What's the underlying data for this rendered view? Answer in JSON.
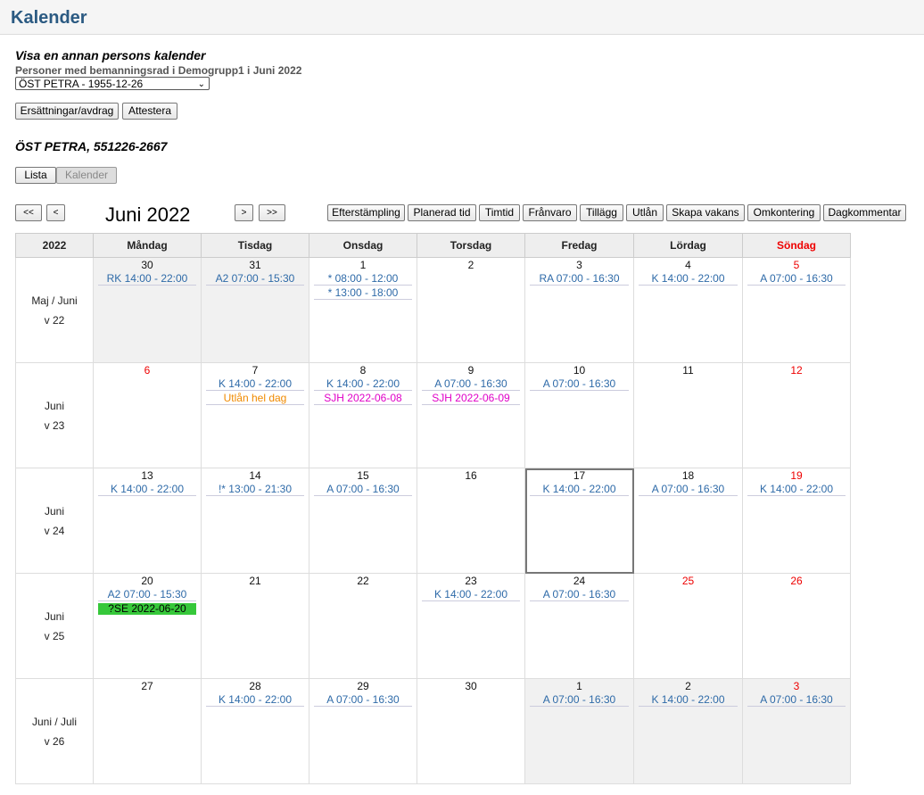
{
  "app_title": "Kalender",
  "section_title": "Visa en annan persons kalender",
  "subtitle": "Personer med bemanningsrad i Demogrupp1 i Juni 2022",
  "person_select": {
    "value": "ÖST PETRA - 1955-12-26",
    "arrow": "⌄"
  },
  "buttons": {
    "ersattningar": "Ersättningar/avdrag",
    "attestera": "Attestera"
  },
  "person_heading": "ÖST PETRA, 551226-2667",
  "view_tabs": {
    "lista": "Lista",
    "kalender": "Kalender"
  },
  "nav": {
    "first": "<<",
    "prev": "<",
    "next": ">",
    "last": ">>"
  },
  "month_title": "Juni 2022",
  "actions": [
    "Efterstämpling",
    "Planerad tid",
    "Timtid",
    "Frånvaro",
    "Tillägg",
    "Utlån",
    "Skapa vakans",
    "Omkontering",
    "Dagkommentar"
  ],
  "table": {
    "year": "2022",
    "days": [
      "Måndag",
      "Tisdag",
      "Onsdag",
      "Torsdag",
      "Fredag",
      "Lördag",
      "Söndag"
    ],
    "weeks": [
      {
        "month": "Maj / Juni",
        "week": "v 22",
        "cells": [
          {
            "day": "30",
            "grey": true,
            "events": [
              {
                "text": "RK 14:00 - 22:00"
              }
            ]
          },
          {
            "day": "31",
            "grey": true,
            "events": [
              {
                "text": "A2 07:00 - 15:30"
              }
            ]
          },
          {
            "day": "1",
            "events": [
              {
                "text": "* 08:00 - 12:00"
              },
              {
                "text": "* 13:00 - 18:00"
              }
            ]
          },
          {
            "day": "2",
            "events": []
          },
          {
            "day": "3",
            "events": [
              {
                "text": "RA 07:00 - 16:30"
              }
            ]
          },
          {
            "day": "4",
            "events": [
              {
                "text": "K 14:00 - 22:00"
              }
            ]
          },
          {
            "day": "5",
            "red": true,
            "events": [
              {
                "text": "A 07:00 - 16:30"
              }
            ]
          }
        ]
      },
      {
        "month": "Juni",
        "week": "v 23",
        "cells": [
          {
            "day": "6",
            "red": true,
            "events": []
          },
          {
            "day": "7",
            "events": [
              {
                "text": "K 14:00 - 22:00"
              },
              {
                "text": "Utlån hel dag",
                "style": "orange"
              }
            ]
          },
          {
            "day": "8",
            "events": [
              {
                "text": "K 14:00 - 22:00"
              },
              {
                "text": "SJH 2022-06-08",
                "style": "magenta"
              }
            ]
          },
          {
            "day": "9",
            "events": [
              {
                "text": "A 07:00 - 16:30"
              },
              {
                "text": "SJH 2022-06-09",
                "style": "magenta"
              }
            ]
          },
          {
            "day": "10",
            "events": [
              {
                "text": "A 07:00 - 16:30"
              }
            ]
          },
          {
            "day": "11",
            "events": []
          },
          {
            "day": "12",
            "red": true,
            "events": []
          }
        ]
      },
      {
        "month": "Juni",
        "week": "v 24",
        "cells": [
          {
            "day": "13",
            "events": [
              {
                "text": "K 14:00 - 22:00"
              }
            ]
          },
          {
            "day": "14",
            "events": [
              {
                "text": "!* 13:00 - 21:30"
              }
            ]
          },
          {
            "day": "15",
            "events": [
              {
                "text": "A 07:00 - 16:30"
              }
            ]
          },
          {
            "day": "16",
            "events": []
          },
          {
            "day": "17",
            "today": true,
            "events": [
              {
                "text": "K 14:00 - 22:00"
              }
            ]
          },
          {
            "day": "18",
            "events": [
              {
                "text": "A 07:00 - 16:30"
              }
            ]
          },
          {
            "day": "19",
            "red": true,
            "events": [
              {
                "text": "K 14:00 - 22:00"
              }
            ]
          }
        ]
      },
      {
        "month": "Juni",
        "week": "v 25",
        "cells": [
          {
            "day": "20",
            "events": [
              {
                "text": "A2 07:00 - 15:30"
              },
              {
                "text": "?SE 2022-06-20",
                "style": "greenbg"
              }
            ]
          },
          {
            "day": "21",
            "events": []
          },
          {
            "day": "22",
            "events": []
          },
          {
            "day": "23",
            "events": [
              {
                "text": "K 14:00 - 22:00"
              }
            ]
          },
          {
            "day": "24",
            "events": [
              {
                "text": "A 07:00 - 16:30"
              }
            ]
          },
          {
            "day": "25",
            "red": true,
            "events": []
          },
          {
            "day": "26",
            "red": true,
            "events": []
          }
        ]
      },
      {
        "month": "Juni / Juli",
        "week": "v 26",
        "cells": [
          {
            "day": "27",
            "events": []
          },
          {
            "day": "28",
            "events": [
              {
                "text": "K 14:00 - 22:00"
              }
            ]
          },
          {
            "day": "29",
            "events": [
              {
                "text": "A 07:00 - 16:30"
              }
            ]
          },
          {
            "day": "30",
            "events": []
          },
          {
            "day": "1",
            "grey": true,
            "events": [
              {
                "text": "A 07:00 - 16:30"
              }
            ]
          },
          {
            "day": "2",
            "grey": true,
            "events": [
              {
                "text": "K 14:00 - 22:00"
              }
            ]
          },
          {
            "day": "3",
            "grey": true,
            "red": true,
            "events": [
              {
                "text": "A 07:00 - 16:30"
              }
            ]
          }
        ]
      }
    ]
  },
  "colors": {
    "title_blue": "#2b5a82",
    "event_blue": "#2e6aa8",
    "sunday_red": "#e00000",
    "orange": "#f08a00",
    "magenta": "#e000c8",
    "green": "#36c83a"
  }
}
